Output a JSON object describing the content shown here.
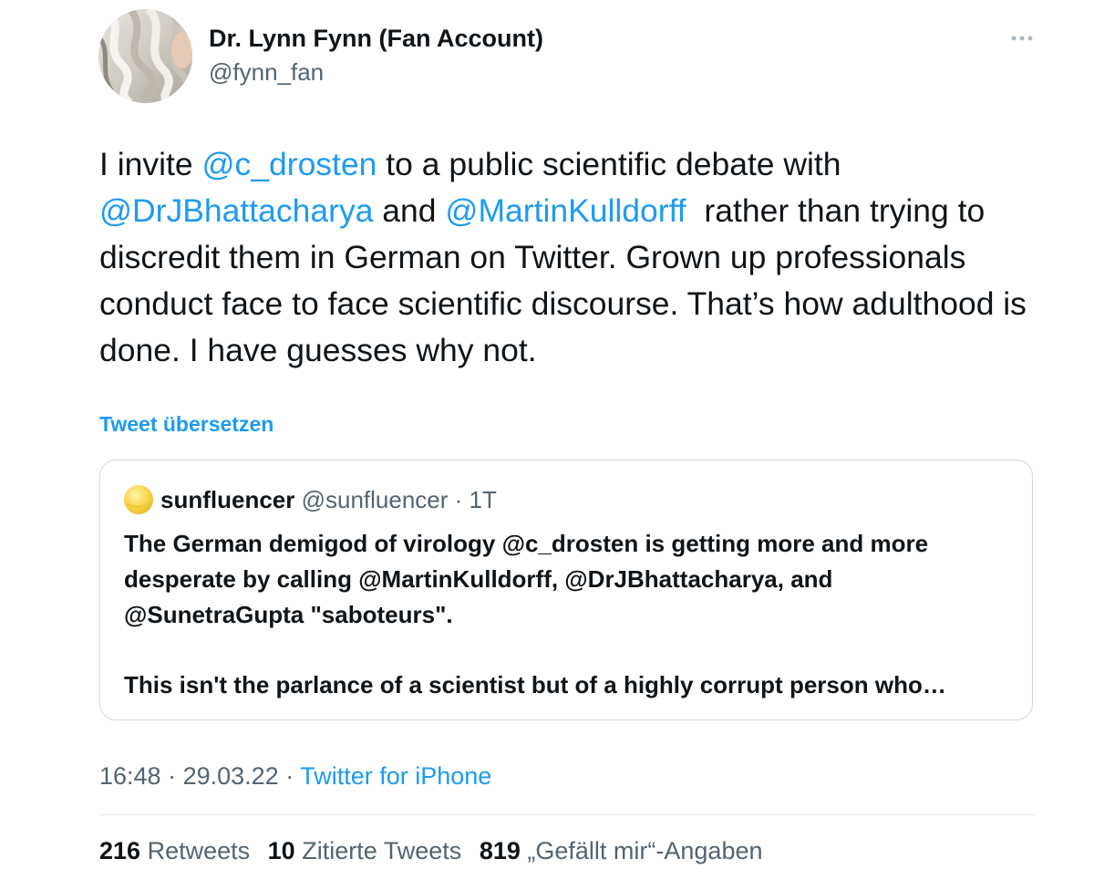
{
  "author": {
    "display_name": "Dr. Lynn Fynn (Fan Account)",
    "handle": "@fynn_fan"
  },
  "tweet": {
    "text_parts": [
      "I invite ",
      "@c_drosten",
      " to a public scientific debate with ",
      "@DrJBhattacharya",
      " and ",
      "@MartinKulldorff",
      "  rather than trying to discredit them in German on Twitter. Grown up professionals conduct face to face scientific discourse. That’s how adulthood is done. I have guesses why not."
    ],
    "translate_label": "Tweet übersetzen"
  },
  "quote": {
    "name": "sunfluencer",
    "handle": "@sunfluencer",
    "separator": " · ",
    "time": "1T",
    "lines": [
      "The German demigod of virology @c_drosten is getting more and more",
      "desperate by calling @MartinKulldorff, @DrJBhattacharya, and",
      "@SunetraGupta \"saboteurs\".",
      "This isn't the parlance of a scientist but of a highly corrupt person who…"
    ]
  },
  "meta": {
    "time": "16:48",
    "sep1": " · ",
    "date": "29.03.22",
    "sep2": " · ",
    "source": "Twitter for iPhone"
  },
  "stats": {
    "retweets_count": "216",
    "retweets_label": "Retweets",
    "quotes_count": "10",
    "quotes_label": "Zitierte Tweets",
    "likes_count": "819",
    "likes_label": "„Gefällt mir“-Angaben"
  },
  "colors": {
    "link": "#1d9bf0",
    "text": "#0f1419",
    "secondary": "#536471",
    "border": "#cfd9de"
  },
  "icons": {
    "more": "more-horizontal-icon",
    "quote_avatar": "sun-avatar-icon"
  }
}
